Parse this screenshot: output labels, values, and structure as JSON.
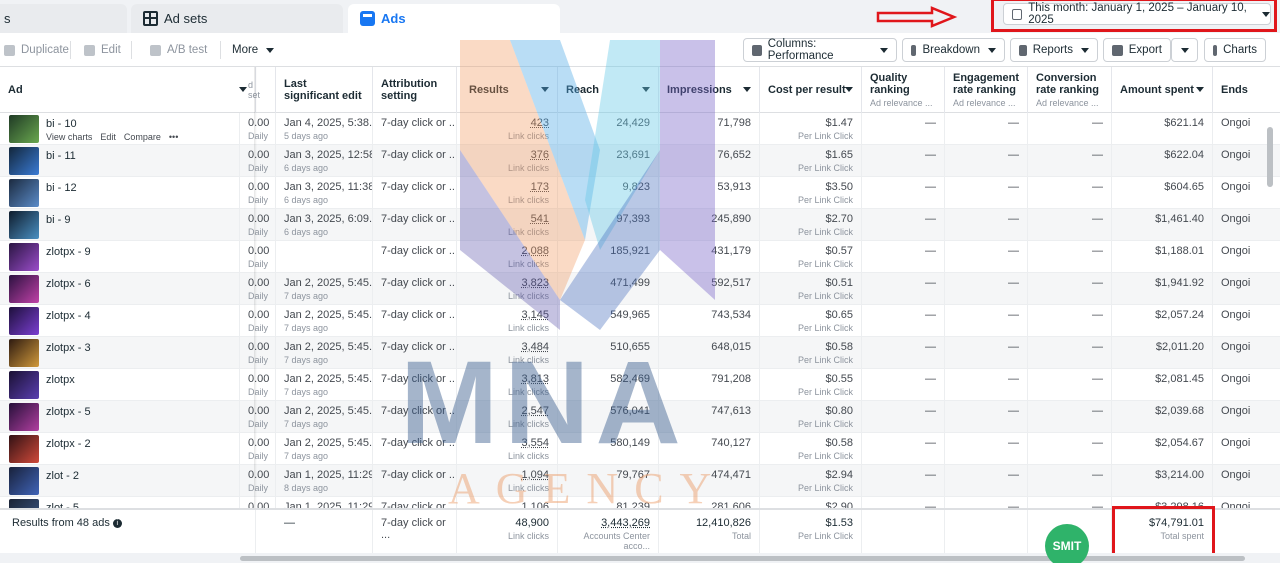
{
  "tabs": [
    {
      "label": "s"
    },
    {
      "label": "Ad sets",
      "icon": "grid-icon"
    },
    {
      "label": "Ads",
      "icon": "ads-icon"
    }
  ],
  "date_range": "This month: January 1, 2025 – January 10, 2025",
  "toolbar": {
    "duplicate": "Duplicate",
    "edit": "Edit",
    "ab_test": "A/B test",
    "more": "More",
    "columns": "Columns: Performance",
    "breakdown": "Breakdown",
    "reports": "Reports",
    "export": "Export",
    "charts": "Charts"
  },
  "columns": {
    "ad": "Ad",
    "adset_fragment": "d set",
    "last_edit": "Last significant edit",
    "attribution": "Attribution setting",
    "results": "Results",
    "reach": "Reach",
    "impressions": "Impressions",
    "cost": "Cost per result",
    "quality": "Quality ranking",
    "quality_sub": "Ad relevance ...",
    "engagement": "Engagement rate ranking",
    "engagement_sub": "Ad relevance ...",
    "conversion": "Conversion rate ranking",
    "conversion_sub": "Ad relevance ...",
    "amount": "Amount spent",
    "ends": "Ends"
  },
  "row_actions": {
    "view": "View charts",
    "edit": "Edit",
    "compare": "Compare",
    "more": "•••"
  },
  "rows": [
    {
      "name": "bi - 10",
      "budget": "0.00",
      "budget_sub": "Daily",
      "edit": "Jan 4, 2025, 5:38...",
      "edit_sub": "5 days ago",
      "attr": "7-day click or ...",
      "results": "423",
      "results_sub": "Link clicks",
      "reach": "24,429",
      "impressions": "71,798",
      "cost": "$1.47",
      "cost_sub": "Per Link Click",
      "q": "—",
      "e": "—",
      "c": "—",
      "amount": "$621.14",
      "ends": "Ongoi",
      "colors": [
        "#1f3a25",
        "#6aa84f"
      ]
    },
    {
      "name": "bi - 11",
      "budget": "0.00",
      "budget_sub": "Daily",
      "edit": "Jan 3, 2025, 12:58...",
      "edit_sub": "6 days ago",
      "attr": "7-day click or ...",
      "results": "376",
      "results_sub": "Link clicks",
      "reach": "23,691",
      "impressions": "76,652",
      "cost": "$1.65",
      "cost_sub": "Per Link Click",
      "q": "—",
      "e": "—",
      "c": "—",
      "amount": "$622.04",
      "ends": "Ongoi",
      "colors": [
        "#12263a",
        "#3a7bd5"
      ]
    },
    {
      "name": "bi - 12",
      "budget": "0.00",
      "budget_sub": "Daily",
      "edit": "Jan 3, 2025, 11:38...",
      "edit_sub": "6 days ago",
      "attr": "7-day click or ...",
      "results": "173",
      "results_sub": "Link clicks",
      "reach": "9,823",
      "impressions": "53,913",
      "cost": "$3.50",
      "cost_sub": "Per Link Click",
      "q": "—",
      "e": "—",
      "c": "—",
      "amount": "$604.65",
      "ends": "Ongoi",
      "colors": [
        "#1b2a3f",
        "#5b8cc9"
      ]
    },
    {
      "name": "bi - 9",
      "budget": "0.00",
      "budget_sub": "Daily",
      "edit": "Jan 3, 2025, 6:09...",
      "edit_sub": "6 days ago",
      "attr": "7-day click or ...",
      "results": "541",
      "results_sub": "Link clicks",
      "reach": "97,393",
      "impressions": "245,890",
      "cost": "$2.70",
      "cost_sub": "Per Link Click",
      "q": "—",
      "e": "—",
      "c": "—",
      "amount": "$1,461.40",
      "ends": "Ongoi",
      "colors": [
        "#0f1c2c",
        "#4a90c2"
      ]
    },
    {
      "name": "zlotpx - 9",
      "budget": "0.00",
      "budget_sub": "Daily",
      "edit": "",
      "edit_sub": "",
      "attr": "7-day click or ...",
      "results": "2,088",
      "results_sub": "Link clicks",
      "reach": "185,921",
      "impressions": "431,179",
      "cost": "$0.57",
      "cost_sub": "Per Link Click",
      "q": "—",
      "e": "—",
      "c": "—",
      "amount": "$1,188.01",
      "ends": "Ongoi",
      "colors": [
        "#2a1542",
        "#9b4dca"
      ]
    },
    {
      "name": "zlotpx - 6",
      "budget": "0.00",
      "budget_sub": "Daily",
      "edit": "Jan 2, 2025, 5:45...",
      "edit_sub": "7 days ago",
      "attr": "7-day click or ...",
      "results": "3,823",
      "results_sub": "Link clicks",
      "reach": "471,499",
      "impressions": "592,517",
      "cost": "$0.51",
      "cost_sub": "Per Link Click",
      "q": "—",
      "e": "—",
      "c": "—",
      "amount": "$1,941.92",
      "ends": "Ongoi",
      "colors": [
        "#2b1140",
        "#c042a8"
      ]
    },
    {
      "name": "zlotpx - 4",
      "budget": "0.00",
      "budget_sub": "Daily",
      "edit": "Jan 2, 2025, 5:45...",
      "edit_sub": "7 days ago",
      "attr": "7-day click or ...",
      "results": "3,145",
      "results_sub": "Link clicks",
      "reach": "549,965",
      "impressions": "743,534",
      "cost": "$0.65",
      "cost_sub": "Per Link Click",
      "q": "—",
      "e": "—",
      "c": "—",
      "amount": "$2,057.24",
      "ends": "Ongoi",
      "colors": [
        "#1d0f3b",
        "#7b3fd1"
      ]
    },
    {
      "name": "zlotpx - 3",
      "budget": "0.00",
      "budget_sub": "Daily",
      "edit": "Jan 2, 2025, 5:45...",
      "edit_sub": "7 days ago",
      "attr": "7-day click or ...",
      "results": "3,484",
      "results_sub": "Link clicks",
      "reach": "510,655",
      "impressions": "648,015",
      "cost": "$0.58",
      "cost_sub": "Per Link Click",
      "q": "—",
      "e": "—",
      "c": "—",
      "amount": "$2,011.20",
      "ends": "Ongoi",
      "colors": [
        "#2d1a10",
        "#d19a3c"
      ]
    },
    {
      "name": "zlotpx",
      "budget": "0.00",
      "budget_sub": "Daily",
      "edit": "Jan 2, 2025, 5:45...",
      "edit_sub": "7 days ago",
      "attr": "7-day click or ...",
      "results": "3,813",
      "results_sub": "Link clicks",
      "reach": "582,469",
      "impressions": "791,208",
      "cost": "$0.55",
      "cost_sub": "Per Link Click",
      "q": "—",
      "e": "—",
      "c": "—",
      "amount": "$2,081.45",
      "ends": "Ongoi",
      "colors": [
        "#1a1033",
        "#5a3fb0"
      ]
    },
    {
      "name": "zlotpx - 5",
      "budget": "0.00",
      "budget_sub": "Daily",
      "edit": "Jan 2, 2025, 5:45...",
      "edit_sub": "7 days ago",
      "attr": "7-day click or ...",
      "results": "2,547",
      "results_sub": "Link clicks",
      "reach": "576,041",
      "impressions": "747,613",
      "cost": "$0.80",
      "cost_sub": "Per Link Click",
      "q": "—",
      "e": "—",
      "c": "—",
      "amount": "$2,039.68",
      "ends": "Ongoi",
      "colors": [
        "#26103a",
        "#b13fa0"
      ]
    },
    {
      "name": "zlotpx - 2",
      "budget": "0.00",
      "budget_sub": "Daily",
      "edit": "Jan 2, 2025, 5:45...",
      "edit_sub": "7 days ago",
      "attr": "7-day click or ...",
      "results": "3,554",
      "results_sub": "Link clicks",
      "reach": "580,149",
      "impressions": "740,127",
      "cost": "$0.58",
      "cost_sub": "Per Link Click",
      "q": "—",
      "e": "—",
      "c": "—",
      "amount": "$2,054.67",
      "ends": "Ongoi",
      "colors": [
        "#311114",
        "#d04a3a"
      ]
    },
    {
      "name": "zlot - 2",
      "budget": "0.00",
      "budget_sub": "Daily",
      "edit": "Jan 1, 2025, 11:29...",
      "edit_sub": "8 days ago",
      "attr": "7-day click or ...",
      "results": "1,094",
      "results_sub": "Link clicks",
      "reach": "79,767",
      "impressions": "474,471",
      "cost": "$2.94",
      "cost_sub": "Per Link Click",
      "q": "—",
      "e": "—",
      "c": "—",
      "amount": "$3,214.00",
      "ends": "Ongoi",
      "colors": [
        "#18213a",
        "#4064b8"
      ]
    },
    {
      "name": "zlot - 5",
      "budget": "0.00",
      "budget_sub": "Daily",
      "edit": "Jan 1, 2025, 11:29...",
      "edit_sub": "",
      "attr": "7-day click or ...",
      "results": "1,106",
      "results_sub": "Link clicks",
      "reach": "81,239",
      "impressions": "281,606",
      "cost": "$2.90",
      "cost_sub": "Per Link Click",
      "q": "—",
      "e": "—",
      "c": "—",
      "amount": "$3,298.16",
      "ends": "Ongoi",
      "colors": [
        "#1a2233",
        "#3d5a8a"
      ]
    }
  ],
  "footer": {
    "label": "Results from 48 ads",
    "edit": "—",
    "attr": "7-day click or ...",
    "results": "48,900",
    "results_sub": "Link clicks",
    "reach": "3,443,269",
    "reach_sub": "Accounts Center acco...",
    "impressions": "12,410,826",
    "impressions_sub": "Total",
    "cost": "$1.53",
    "cost_sub": "Per Link Click",
    "amount": "$74,791.01",
    "amount_sub": "Total spent"
  },
  "watermark": {
    "top": "MNA",
    "bottom": "AGENCY"
  },
  "badge": "SMIT",
  "colors": {
    "accent": "#1877f2",
    "highlight": "#e0161b",
    "badge": "#2fb36a"
  }
}
